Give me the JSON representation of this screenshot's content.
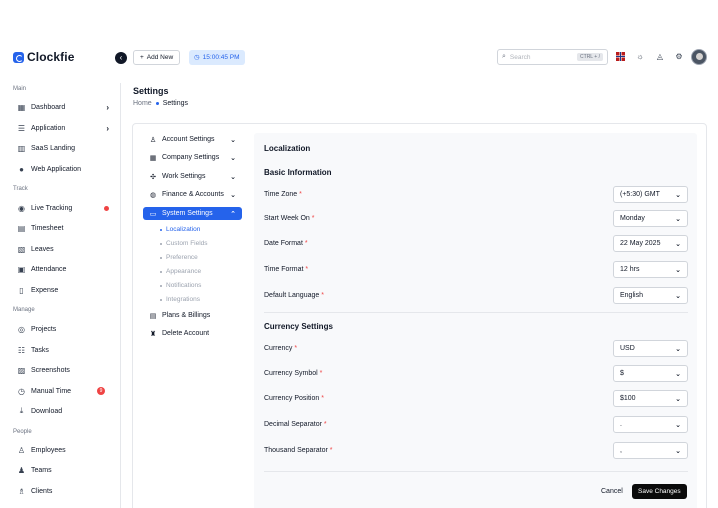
{
  "brand": {
    "name": "Clockfie",
    "accent": "#2563eb"
  },
  "topbar": {
    "add_new": "Add New",
    "clock": "15:00:45 PM",
    "search_placeholder": "Search",
    "search_shortcut": "CTRL + /"
  },
  "sidebar": {
    "sections": [
      {
        "title": "Main",
        "items": [
          {
            "label": "Dashboard",
            "icon": "grid-icon",
            "chevron": true
          },
          {
            "label": "Application",
            "icon": "layers-icon",
            "chevron": true
          },
          {
            "label": "SaaS Landing",
            "icon": "layout-icon"
          },
          {
            "label": "Web Application",
            "icon": "chat-icon"
          }
        ]
      },
      {
        "title": "Track",
        "items": [
          {
            "label": "Live Tracking",
            "icon": "live-icon",
            "dot": true
          },
          {
            "label": "Timesheet",
            "icon": "sheet-icon"
          },
          {
            "label": "Leaves",
            "icon": "leave-icon"
          },
          {
            "label": "Attendance",
            "icon": "calendar-icon"
          },
          {
            "label": "Expense",
            "icon": "receipt-icon"
          }
        ]
      },
      {
        "title": "Manage",
        "items": [
          {
            "label": "Projects",
            "icon": "target-icon"
          },
          {
            "label": "Tasks",
            "icon": "tasks-icon"
          },
          {
            "label": "Screenshots",
            "icon": "image-icon"
          },
          {
            "label": "Manual Time",
            "icon": "clock-icon",
            "count": "9"
          },
          {
            "label": "Download",
            "icon": "download-icon"
          }
        ]
      },
      {
        "title": "People",
        "items": [
          {
            "label": "Employees",
            "icon": "user-icon"
          },
          {
            "label": "Teams",
            "icon": "team-icon"
          },
          {
            "label": "Clients",
            "icon": "clients-icon"
          }
        ]
      }
    ]
  },
  "page": {
    "title": "Settings",
    "breadcrumb": [
      "Home",
      "Settings"
    ]
  },
  "settings_nav": {
    "items": [
      {
        "label": "Account Settings",
        "icon": "user-cog-icon",
        "chevron": true
      },
      {
        "label": "Company Settings",
        "icon": "building-icon",
        "chevron": true
      },
      {
        "label": "Work Settings",
        "icon": "work-icon",
        "chevron": true
      },
      {
        "label": "Finance & Accounts",
        "icon": "finance-icon",
        "chevron": true
      },
      {
        "label": "System Settings",
        "icon": "monitor-icon",
        "chevron": true,
        "active": true
      }
    ],
    "sub_items": [
      "Localization",
      "Custom Fields",
      "Preference",
      "Appearance",
      "Notifications",
      "Integrations"
    ],
    "tail_items": [
      {
        "label": "Plans & Billings",
        "icon": "bill-icon"
      },
      {
        "label": "Delete Account",
        "icon": "trash-icon"
      }
    ]
  },
  "localization": {
    "title": "Localization",
    "basic": {
      "heading": "Basic Information",
      "fields": [
        {
          "label": "Time Zone",
          "value": "(+5:30) GMT"
        },
        {
          "label": "Start Week On",
          "value": "Monday"
        },
        {
          "label": "Date Format",
          "value": "22 May 2025"
        },
        {
          "label": "Time Format",
          "value": "12 hrs"
        },
        {
          "label": "Default Language",
          "value": "English"
        }
      ]
    },
    "currency": {
      "heading": "Currency Settings",
      "fields": [
        {
          "label": "Currency",
          "value": "USD"
        },
        {
          "label": "Currency Symbol",
          "value": "$"
        },
        {
          "label": "Currency Position",
          "value": "$100"
        },
        {
          "label": "Decimal Separator",
          "value": "."
        },
        {
          "label": "Thousand Separator",
          "value": ","
        }
      ]
    },
    "cancel_label": "Cancel",
    "save_label": "Save Changes"
  }
}
